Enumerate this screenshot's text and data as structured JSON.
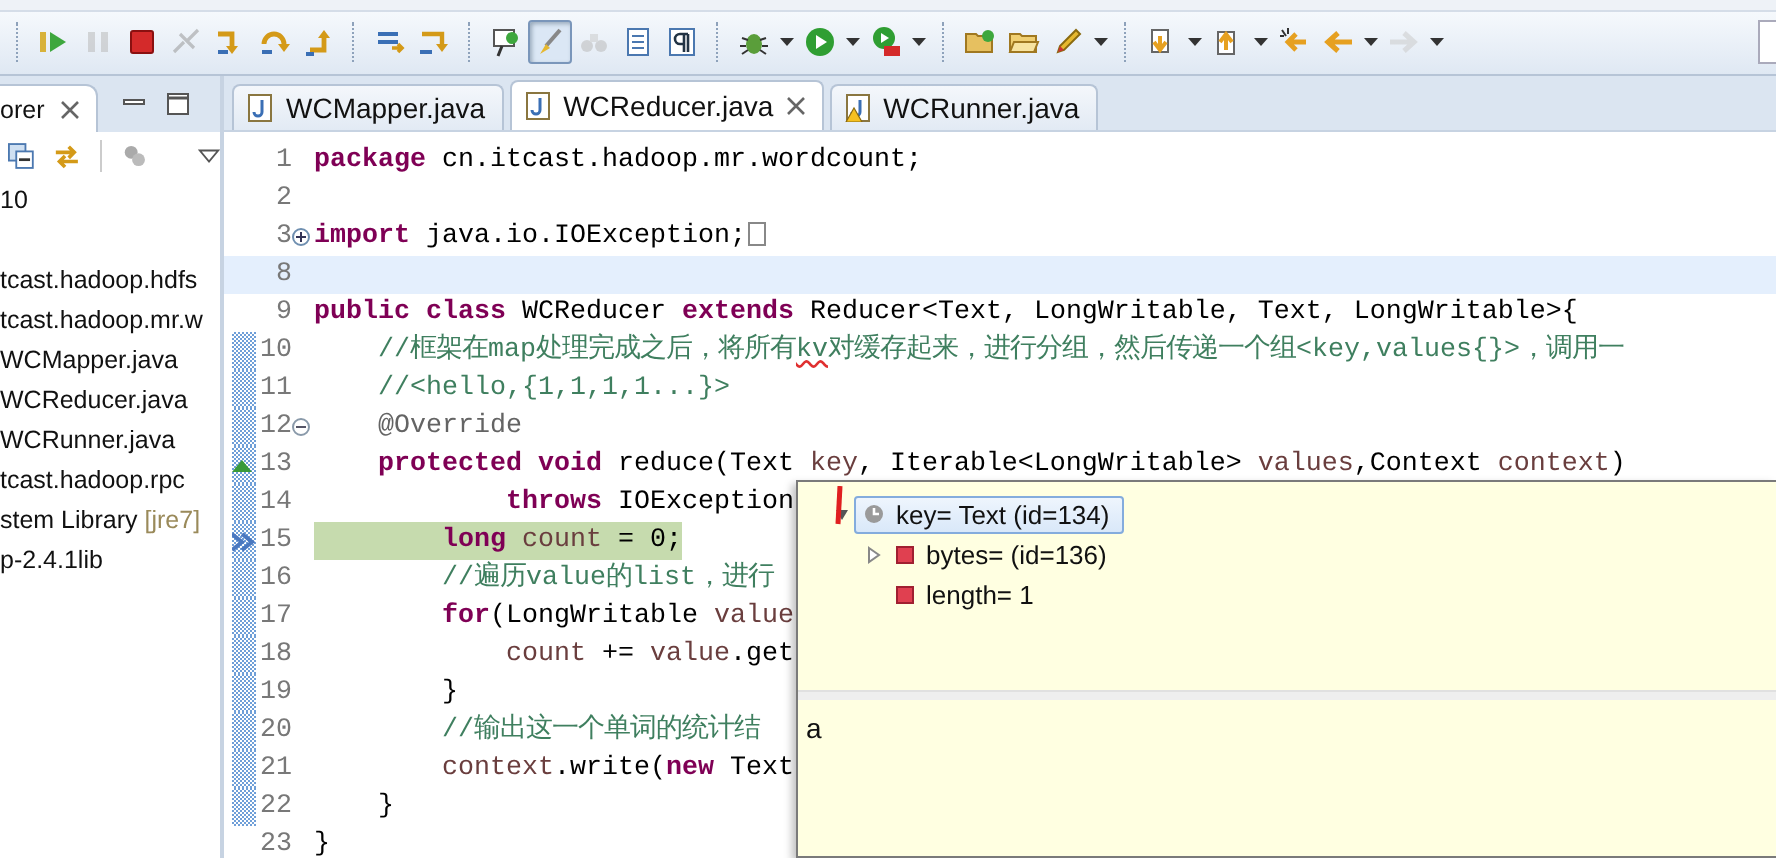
{
  "toolbar": [
    {
      "kind": "separator"
    },
    {
      "kind": "resume",
      "pressed": false,
      "disabled": false
    },
    {
      "kind": "suspend",
      "pressed": false,
      "disabled": true
    },
    {
      "kind": "terminate",
      "pressed": false,
      "disabled": false
    },
    {
      "kind": "disconnect",
      "pressed": false,
      "disabled": true
    },
    {
      "kind": "step-into",
      "pressed": false,
      "disabled": false
    },
    {
      "kind": "step-over",
      "pressed": false,
      "disabled": false
    },
    {
      "kind": "step-return",
      "pressed": false,
      "disabled": false
    },
    {
      "kind": "separator"
    },
    {
      "kind": "drop-frame",
      "pressed": false,
      "disabled": false
    },
    {
      "kind": "step-filters",
      "pressed": false,
      "disabled": false
    },
    {
      "kind": "separator"
    },
    {
      "kind": "pin",
      "pressed": false,
      "disabled": false
    },
    {
      "kind": "brush",
      "pressed": true,
      "disabled": false
    },
    {
      "kind": "binoculars",
      "pressed": false,
      "disabled": true
    },
    {
      "kind": "doc",
      "pressed": false,
      "disabled": false
    },
    {
      "kind": "pilcrow",
      "pressed": false,
      "disabled": false
    },
    {
      "kind": "separator"
    },
    {
      "kind": "bug",
      "pressed": false,
      "disabled": false
    },
    {
      "kind": "dropdown",
      "pressed": false,
      "disabled": false
    },
    {
      "kind": "run",
      "pressed": false,
      "disabled": false
    },
    {
      "kind": "dropdown",
      "pressed": false,
      "disabled": false
    },
    {
      "kind": "run-ext",
      "pressed": false,
      "disabled": false
    },
    {
      "kind": "dropdown",
      "pressed": false,
      "disabled": false
    },
    {
      "kind": "separator"
    },
    {
      "kind": "open-folder",
      "pressed": false,
      "disabled": false
    },
    {
      "kind": "folder",
      "pressed": false,
      "disabled": false
    },
    {
      "kind": "pencil",
      "pressed": false,
      "disabled": false
    },
    {
      "kind": "dropdown",
      "pressed": false,
      "disabled": false
    },
    {
      "kind": "separator"
    },
    {
      "kind": "next-annotation",
      "pressed": false,
      "disabled": false
    },
    {
      "kind": "dropdown",
      "pressed": false,
      "disabled": false
    },
    {
      "kind": "prev-annotation",
      "pressed": false,
      "disabled": false
    },
    {
      "kind": "dropdown",
      "pressed": false,
      "disabled": false
    },
    {
      "kind": "last-edit",
      "pressed": false,
      "disabled": false
    },
    {
      "kind": "back",
      "pressed": false,
      "disabled": false
    },
    {
      "kind": "dropdown",
      "pressed": false,
      "disabled": false
    },
    {
      "kind": "forward",
      "pressed": false,
      "disabled": true
    },
    {
      "kind": "dropdown",
      "pressed": false,
      "disabled": false
    }
  ],
  "explorer": {
    "title": "orer",
    "items": [
      {
        "label": "10"
      },
      {
        "label": "tcast.hadoop.hdfs"
      },
      {
        "label": "tcast.hadoop.mr.w"
      },
      {
        "label": "WCMapper.java"
      },
      {
        "label": "WCReducer.java"
      },
      {
        "label": "WCRunner.java"
      },
      {
        "label": "tcast.hadoop.rpc"
      },
      {
        "label": "stem Library",
        "note": "[jre7]"
      },
      {
        "label": "p-2.4.1lib"
      }
    ]
  },
  "editor_tabs": [
    {
      "label": "WCMapper.java",
      "selected": false,
      "warning": false
    },
    {
      "label": "WCReducer.java",
      "selected": true,
      "warning": false
    },
    {
      "label": "WCRunner.java",
      "selected": false,
      "warning": true
    }
  ],
  "code": [
    {
      "number": "1",
      "changed": false,
      "cursor": false,
      "debug": false,
      "tokens": [
        {
          "kind": "keyword",
          "t": "package"
        },
        {
          "kind": "plain",
          "t": " cn.itcast.hadoop.mr.wordcount;"
        }
      ]
    },
    {
      "number": "2",
      "changed": false,
      "cursor": false,
      "debug": false
    },
    {
      "number": "3",
      "changed": false,
      "cursor": false,
      "debug": false,
      "gutter": [
        {
          "kind": "fold-collapsed"
        }
      ],
      "tokens": [
        {
          "kind": "keyword",
          "t": "import"
        },
        {
          "kind": "plain",
          "t": " java.io.IOException;"
        },
        {
          "kind": "box"
        }
      ]
    },
    {
      "number": "8",
      "changed": false,
      "cursor": true,
      "debug": false
    },
    {
      "number": "9",
      "changed": false,
      "cursor": false,
      "debug": false,
      "tokens": [
        {
          "kind": "keyword",
          "t": "public class"
        },
        {
          "kind": "plain",
          "t": " WCReducer "
        },
        {
          "kind": "keyword",
          "t": "extends"
        },
        {
          "kind": "plain",
          "t": " Reducer<Text, LongWritable, Text, LongWritable>{"
        }
      ]
    },
    {
      "number": "10",
      "changed": true,
      "cursor": false,
      "debug": false,
      "tokens": [
        {
          "kind": "comment",
          "t": "    //框架在map处理完成之后，将所有"
        },
        {
          "kind": "misspelled",
          "t": "kv"
        },
        {
          "kind": "comment",
          "t": "对缓存起来，进行分组，然后传递一个组<key,values{}>，调用一"
        }
      ]
    },
    {
      "number": "11",
      "changed": true,
      "cursor": false,
      "debug": false,
      "tokens": [
        {
          "kind": "comment",
          "t": "    //<hello,{1,1,1,1...}>"
        }
      ]
    },
    {
      "number": "12",
      "changed": true,
      "cursor": false,
      "debug": false,
      "gutter": [
        {
          "kind": "fold-expanded"
        }
      ],
      "tokens": [
        {
          "kind": "annotation",
          "t": "    @Override"
        }
      ]
    },
    {
      "number": "13",
      "changed": true,
      "cursor": false,
      "debug": false,
      "gutter": [
        {
          "kind": "override"
        }
      ],
      "tokens": [
        {
          "kind": "keyword",
          "t": "    protected void"
        },
        {
          "kind": "plain",
          "t": " reduce(Text "
        },
        {
          "kind": "variable",
          "t": "key"
        },
        {
          "kind": "plain",
          "t": ", Iterable<LongWritable> "
        },
        {
          "kind": "variable",
          "t": "values"
        },
        {
          "kind": "plain",
          "t": ",Context "
        },
        {
          "kind": "variable",
          "t": "context"
        },
        {
          "kind": "plain",
          "t": ")"
        }
      ]
    },
    {
      "number": "14",
      "changed": true,
      "cursor": false,
      "debug": false,
      "tokens": [
        {
          "kind": "keyword",
          "t": "            throws"
        },
        {
          "kind": "plain",
          "t": " IOException"
        }
      ]
    },
    {
      "number": "15",
      "changed": true,
      "cursor": false,
      "debug": true,
      "gutter": [
        {
          "kind": "debug-pointer"
        }
      ],
      "tokens": [
        {
          "kind": "keyword",
          "t": "        long"
        },
        {
          "kind": "variable",
          "t": " count"
        },
        {
          "kind": "plain",
          "t": " = 0;"
        }
      ]
    },
    {
      "number": "16",
      "changed": true,
      "cursor": false,
      "debug": false,
      "tokens": [
        {
          "kind": "comment",
          "t": "        //遍历value的list，进行"
        }
      ]
    },
    {
      "number": "17",
      "changed": true,
      "cursor": false,
      "debug": false,
      "tokens": [
        {
          "kind": "keyword",
          "t": "        for"
        },
        {
          "kind": "plain",
          "t": "(LongWritable "
        },
        {
          "kind": "variable",
          "t": "value"
        }
      ]
    },
    {
      "number": "18",
      "changed": true,
      "cursor": false,
      "debug": false,
      "tokens": [
        {
          "kind": "variable",
          "t": "            count"
        },
        {
          "kind": "plain",
          "t": " += "
        },
        {
          "kind": "variable",
          "t": "value"
        },
        {
          "kind": "plain",
          "t": ".get"
        }
      ]
    },
    {
      "number": "19",
      "changed": true,
      "cursor": false,
      "debug": false,
      "tokens": [
        {
          "kind": "plain",
          "t": "        }"
        }
      ]
    },
    {
      "number": "20",
      "changed": true,
      "cursor": false,
      "debug": false,
      "tokens": [
        {
          "kind": "comment",
          "t": "        //输出这一个单词的统计结"
        }
      ]
    },
    {
      "number": "21",
      "changed": true,
      "cursor": false,
      "debug": false,
      "tokens": [
        {
          "kind": "variable",
          "t": "        context"
        },
        {
          "kind": "plain",
          "t": ".write("
        },
        {
          "kind": "keyword",
          "t": "new"
        },
        {
          "kind": "plain",
          "t": " Text"
        }
      ]
    },
    {
      "number": "22",
      "changed": true,
      "cursor": false,
      "debug": false,
      "tokens": [
        {
          "kind": "plain",
          "t": "    }"
        }
      ]
    },
    {
      "number": "23",
      "changed": false,
      "cursor": false,
      "debug": false,
      "tokens": [
        {
          "kind": "plain",
          "t": "}"
        }
      ]
    }
  ],
  "hover": {
    "tree": [
      {
        "label": "key= Text  (id=134)",
        "kind": "object",
        "selected": true,
        "expanded": true,
        "children": [
          {
            "label": "bytes=  (id=136)",
            "kind": "field",
            "selected": false,
            "expanded": false
          },
          {
            "label": "length= 1",
            "kind": "field",
            "selected": false
          }
        ]
      }
    ],
    "detail": "a"
  }
}
